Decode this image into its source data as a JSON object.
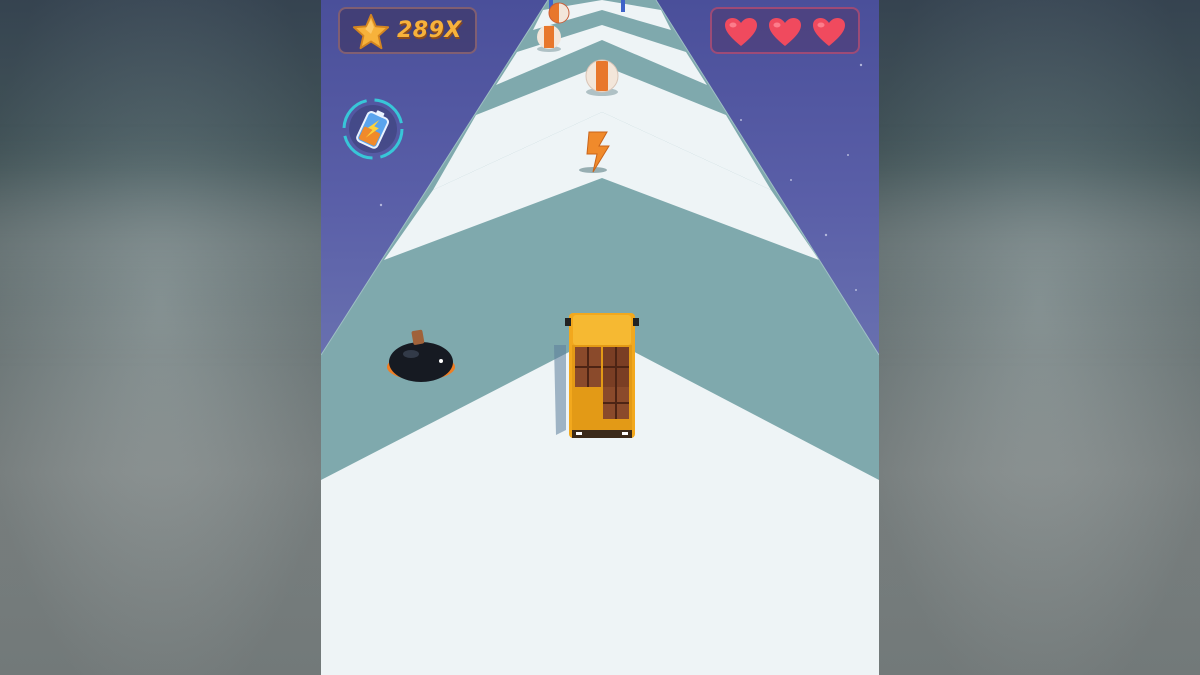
{
  "hud": {
    "score_label": "289X",
    "lives": 3,
    "icons": {
      "score": "star-icon",
      "lives": "heart-icon",
      "powerup": "battery-icon"
    }
  },
  "scene": {
    "player": "truck-with-crates",
    "obstacles": [
      "bomb",
      "striped-ball",
      "striped-ball",
      "striped-ball",
      "lightning-bolt-pickup"
    ]
  },
  "colors": {
    "sky": "#5a5fa8",
    "road_light": "#eef4f6",
    "road_dark": "#7fa8ad",
    "accent_orange": "#f7b23b",
    "heart_red": "#f04a5e",
    "power_cyan": "#38c6d8"
  }
}
